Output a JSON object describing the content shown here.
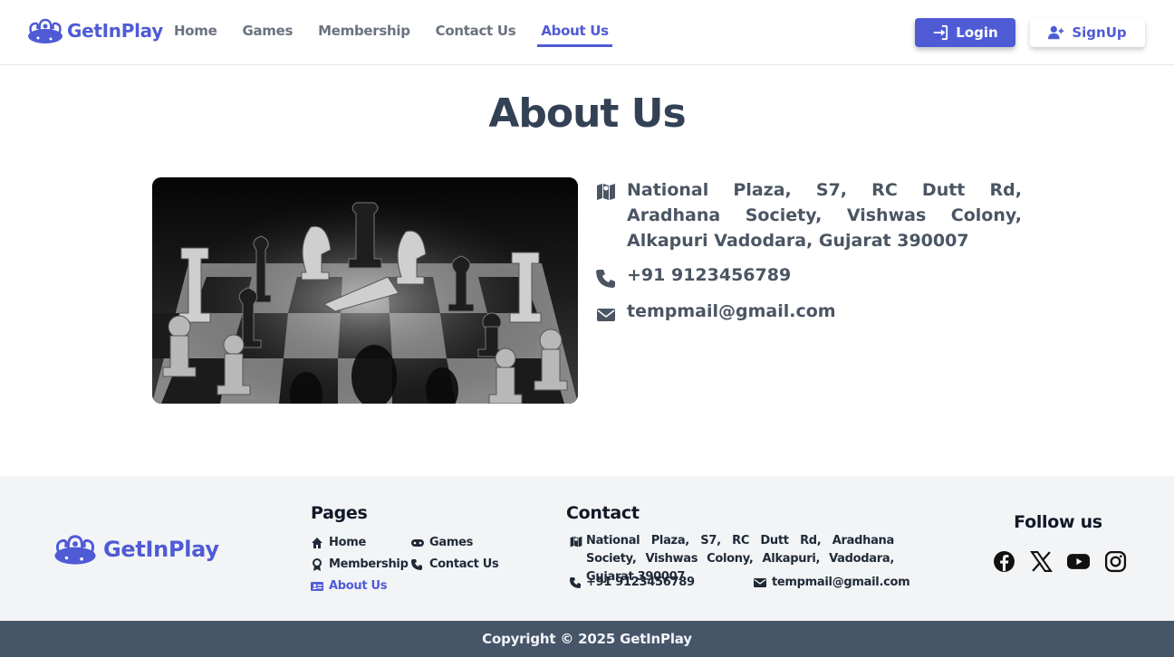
{
  "brand": {
    "name": "GetInPlay",
    "accent_color": "#4f5bd5"
  },
  "nav": {
    "items": [
      {
        "label": "Home"
      },
      {
        "label": "Games"
      },
      {
        "label": "Membership"
      },
      {
        "label": "Contact Us"
      },
      {
        "label": "About Us",
        "active": true
      }
    ],
    "login_label": "Login",
    "signup_label": "SignUp"
  },
  "main": {
    "title": "About Us",
    "image_icon": "chess-photo",
    "address": "National Plaza, S7, RC Dutt Rd, Aradhana Society, Vishwas Colony, Alkapuri Vadodara, Gujarat 390007",
    "phone": "+91 9123456789",
    "email": "tempmail@gmail.com"
  },
  "footer": {
    "pages_heading": "Pages",
    "pages": [
      {
        "label": "Home",
        "icon": "home-icon"
      },
      {
        "label": "Games",
        "icon": "gamepad-icon"
      },
      {
        "label": "Membership",
        "icon": "award-icon"
      },
      {
        "label": "Contact Us",
        "icon": "phone-icon"
      },
      {
        "label": "About Us",
        "icon": "id-card-icon",
        "active": true
      }
    ],
    "contact_heading": "Contact",
    "address": "National Plaza, S7, RC Dutt Rd, Aradhana Society, Vishwas Colony, Alkapuri, Vadodara, Gujarat 390007",
    "phone": "+91 9123456789",
    "email": "tempmail@gmail.com",
    "follow_heading": "Follow us",
    "socials": [
      "facebook-icon",
      "x-icon",
      "youtube-icon",
      "instagram-icon"
    ],
    "copyright": "Copyright © 2025 GetInPlay"
  }
}
